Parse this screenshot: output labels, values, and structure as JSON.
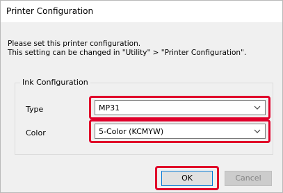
{
  "window": {
    "title": "Printer Configuration"
  },
  "message": {
    "line1": "Please set this printer configuration.",
    "line2": "This setting can be changed in \"Utility\" > \"Printer Configuration\"."
  },
  "ink_configuration": {
    "group_title": "Ink Configuration",
    "type": {
      "label": "Type",
      "value": "MP31"
    },
    "color": {
      "label": "Color",
      "value": "5-Color (KCMYW)"
    }
  },
  "buttons": {
    "ok_label": "OK",
    "cancel_label": "Cancel"
  },
  "colors": {
    "highlight": "#e0002a",
    "ok_border": "#0078d7",
    "dialog_background": "#f0f0f0"
  },
  "icons": {
    "dropdown": "chevron-down-icon"
  }
}
